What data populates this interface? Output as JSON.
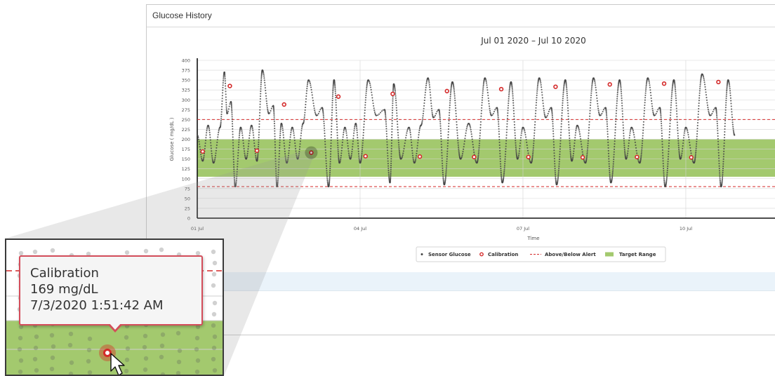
{
  "panel": {
    "title": "Glucose History"
  },
  "colors": {
    "target_range": "#a3c96e",
    "sensor": "#444444",
    "calibration": "#d42a2a",
    "alert_line": "#d42a2a",
    "grid": "#d4d4d4"
  },
  "chart_data": {
    "type": "scatter",
    "title": "Jul 01 2020 – Jul 10 2020",
    "xlabel": "Time",
    "ylabel": "Glucose ( mg/dL )",
    "ylim": [
      0,
      400
    ],
    "y_ticks": [
      "0",
      "25",
      "50",
      "75",
      "100",
      "125",
      "150",
      "175",
      "200",
      "225",
      "250",
      "275",
      "300",
      "325",
      "350",
      "375",
      "400"
    ],
    "x_range_days": [
      1,
      11
    ],
    "x_ticks": [
      {
        "day": 1,
        "label": "01 Jul"
      },
      {
        "day": 4,
        "label": "04 Jul"
      },
      {
        "day": 7,
        "label": "07 Jul"
      },
      {
        "day": 10,
        "label": "10 Jul"
      }
    ],
    "grid": true,
    "legend_position": "bottom",
    "target_range": [
      105,
      200
    ],
    "alert_lines": [
      250,
      80
    ],
    "series": [
      {
        "name": "Sensor Glucose",
        "kind": "points",
        "x_day": [
          1.0,
          1.1,
          1.2,
          1.3,
          1.42,
          1.5,
          1.55,
          1.62,
          1.7,
          1.8,
          1.9,
          2.0,
          2.1,
          2.2,
          2.32,
          2.4,
          2.47,
          2.55,
          2.65,
          2.75,
          2.85,
          2.95,
          3.05,
          3.2,
          3.3,
          3.42,
          3.52,
          3.62,
          3.72,
          3.82,
          3.92,
          4.0,
          4.15,
          4.3,
          4.45,
          4.55,
          4.62,
          4.75,
          4.9,
          5.0,
          5.12,
          5.25,
          5.35,
          5.45,
          5.55,
          5.7,
          5.85,
          6.0,
          6.15,
          6.3,
          6.42,
          6.52,
          6.62,
          6.78,
          6.9,
          7.0,
          7.15,
          7.3,
          7.42,
          7.52,
          7.62,
          7.78,
          7.9,
          8.0,
          8.15,
          8.3,
          8.42,
          8.52,
          8.62,
          8.78,
          8.9,
          9.0,
          9.15,
          9.3,
          9.42,
          9.52,
          9.62,
          9.78,
          9.9,
          10.0,
          10.15,
          10.3,
          10.45,
          10.55,
          10.65,
          10.78,
          10.9
        ],
        "y": [
          210,
          145,
          235,
          140,
          230,
          370,
          265,
          295,
          80,
          230,
          150,
          235,
          145,
          375,
          265,
          285,
          80,
          240,
          140,
          230,
          150,
          240,
          350,
          260,
          280,
          80,
          350,
          140,
          230,
          150,
          240,
          140,
          350,
          260,
          275,
          90,
          340,
          150,
          230,
          140,
          235,
          355,
          255,
          275,
          85,
          345,
          150,
          240,
          140,
          355,
          260,
          280,
          90,
          345,
          150,
          230,
          140,
          355,
          255,
          280,
          85,
          350,
          145,
          235,
          140,
          355,
          260,
          280,
          90,
          350,
          150,
          230,
          140,
          355,
          260,
          280,
          80,
          350,
          150,
          230,
          140,
          365,
          260,
          280,
          80,
          350,
          210
        ]
      },
      {
        "name": "Calibration",
        "kind": "markers",
        "x_day": [
          1.1,
          1.6,
          2.1,
          2.6,
          3.1,
          3.6,
          4.1,
          4.6,
          5.1,
          5.6,
          6.1,
          6.6,
          7.1,
          7.6,
          8.1,
          8.6,
          9.1,
          9.6,
          10.1,
          10.6
        ],
        "y": [
          169,
          335,
          171,
          288,
          166,
          308,
          157,
          315,
          156,
          322,
          155,
          327,
          155,
          333,
          154,
          339,
          155,
          341,
          154,
          345
        ]
      },
      {
        "name": "Above/Below Alert",
        "kind": "dashed-lines"
      },
      {
        "name": "Target Range",
        "kind": "band"
      }
    ]
  },
  "tooltip": {
    "title": "Calibration",
    "value": "169 mg/dL",
    "timestamp": "7/3/2020 1:51:42 AM"
  }
}
